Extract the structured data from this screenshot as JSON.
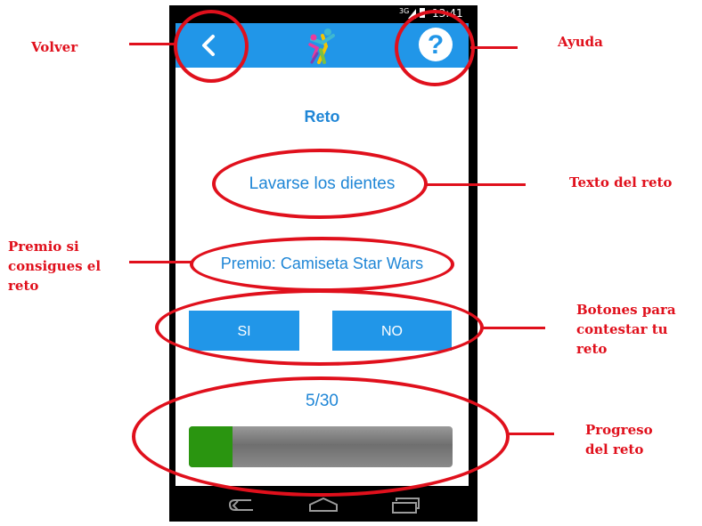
{
  "status_bar": {
    "network": "3G",
    "time": "13:41"
  },
  "app_bar": {
    "back_icon": "chevron-left-icon",
    "logo_icon": "app-logo-icon",
    "help_label": "?"
  },
  "screen": {
    "title": "Reto",
    "challenge_text": "Lavarse los dientes",
    "prize_text": "Premio: Camiseta Star Wars",
    "yes_label": "SI",
    "no_label": "NO",
    "progress_text": "5/30",
    "progress": {
      "value": 5,
      "max": 30
    }
  },
  "nav_bar": {
    "items": [
      "back-icon",
      "home-icon",
      "recents-icon"
    ]
  },
  "annotations": {
    "back": "Volver",
    "help": "Ayuda",
    "challenge": "Texto del reto",
    "prize": "Premio si consigues el reto",
    "buttons": "Botones para contestar tu reto",
    "progress": "Progreso del reto"
  },
  "colors": {
    "primary": "#2196e8",
    "text_blue": "#1f86d6",
    "progress_fill": "#2a9510",
    "annotation": "#e0101c"
  }
}
